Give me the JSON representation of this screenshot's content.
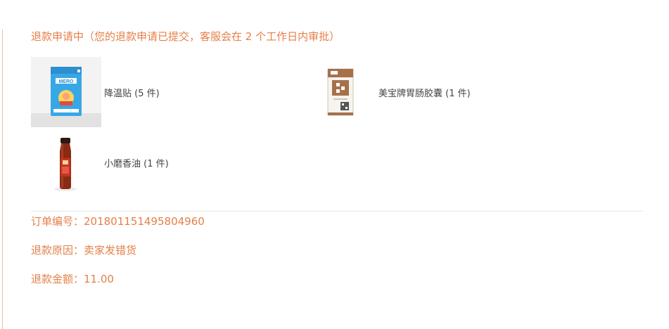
{
  "refund": {
    "status_title": "退款申请中（您的退款申请已提交，客服会在 2 个工作日内审批）",
    "items": [
      {
        "name": "降温贴 (5 件)",
        "image_icon": "cooling-patch-box-image"
      },
      {
        "name": "美宝牌胃肠胶囊 (1 件)",
        "image_icon": "capsule-box-image"
      },
      {
        "name": "小磨香油 (1 件)",
        "image_icon": "sesame-oil-bottle-image"
      }
    ],
    "order_number": "订单编号：201801151495804960",
    "reason": "退款原因：卖家发错货",
    "amount": "退款金额：11.00"
  },
  "colors": {
    "accent": "#e57f49",
    "item_text": "#444444",
    "divider": "#e5e5e5",
    "left_rule": "#e3bf9a"
  }
}
